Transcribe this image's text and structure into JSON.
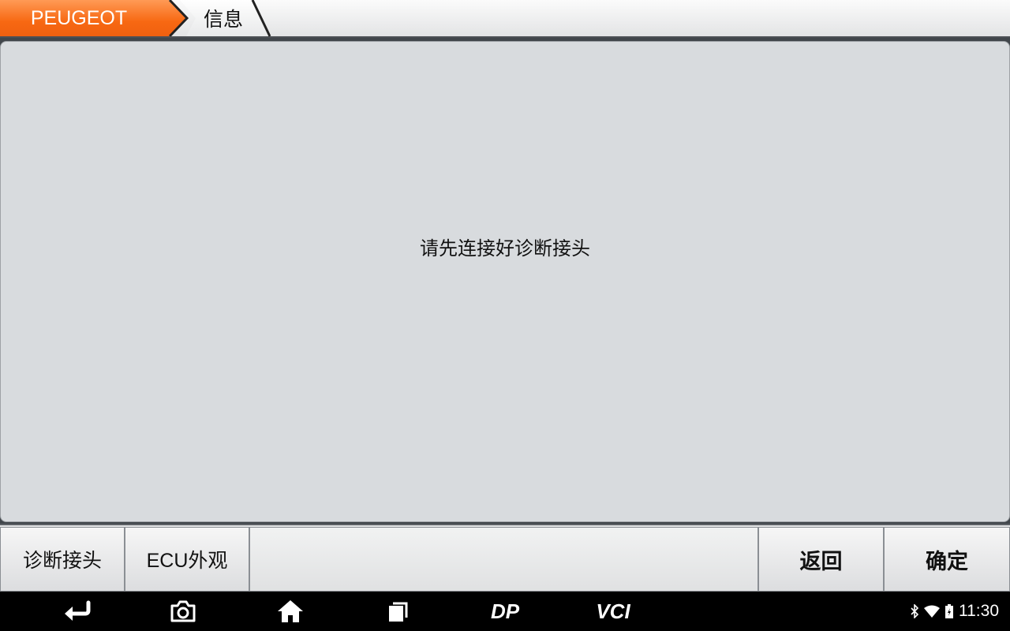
{
  "breadcrumb": {
    "brand": "PEUGEOT",
    "current": "信息"
  },
  "content": {
    "message": "请先连接好诊断接头"
  },
  "function_bar": {
    "connector_label": "诊断接头",
    "ecu_label": "ECU外观",
    "back_label": "返回",
    "ok_label": "确定"
  },
  "nav_bar": {
    "icons": [
      "back-icon",
      "camera-icon",
      "home-icon",
      "recent-apps-icon",
      "dp-icon",
      "vci-icon"
    ],
    "dp_text": "DP",
    "vci_text": "VCI"
  },
  "status_bar": {
    "icons": [
      "bluetooth-icon",
      "wifi-icon",
      "battery-icon"
    ],
    "time": "11:30"
  },
  "colors": {
    "accent_orange": "#f76812",
    "content_bg": "#d8dbde",
    "nav_bg": "#000000"
  }
}
